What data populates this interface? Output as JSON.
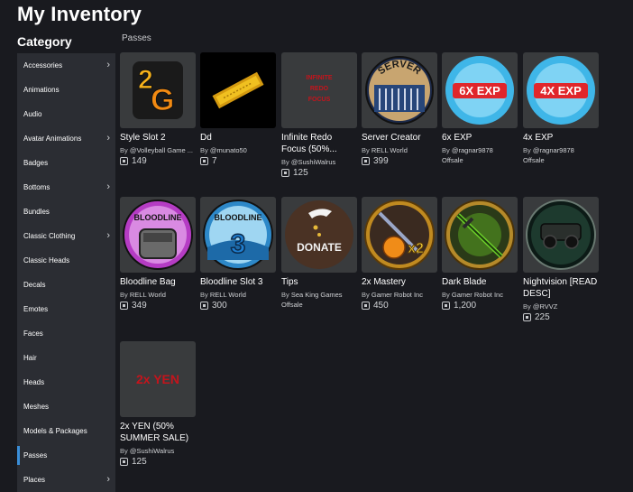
{
  "page_title": "My Inventory",
  "category_title": "Category",
  "section_label": "Passes",
  "sidebar": {
    "items": [
      {
        "label": "Accessories",
        "chevron": true
      },
      {
        "label": "Animations",
        "chevron": false
      },
      {
        "label": "Audio",
        "chevron": false
      },
      {
        "label": "Avatar Animations",
        "chevron": true
      },
      {
        "label": "Badges",
        "chevron": false
      },
      {
        "label": "Bottoms",
        "chevron": true
      },
      {
        "label": "Bundles",
        "chevron": false
      },
      {
        "label": "Classic Clothing",
        "chevron": true
      },
      {
        "label": "Classic Heads",
        "chevron": false
      },
      {
        "label": "Decals",
        "chevron": false
      },
      {
        "label": "Emotes",
        "chevron": false
      },
      {
        "label": "Faces",
        "chevron": false
      },
      {
        "label": "Hair",
        "chevron": false
      },
      {
        "label": "Heads",
        "chevron": false
      },
      {
        "label": "Meshes",
        "chevron": false
      },
      {
        "label": "Models & Packages",
        "chevron": false
      },
      {
        "label": "Passes",
        "chevron": false,
        "active": true
      },
      {
        "label": "Places",
        "chevron": true
      }
    ]
  },
  "items": [
    {
      "name": "Style Slot 2",
      "by": "By",
      "creator": "@Volleyball Game ...",
      "price": "149",
      "icon": "style-slot-icon"
    },
    {
      "name": "Dd",
      "by": "By",
      "creator": "@munato50",
      "price": "7",
      "icon": "gold-ticket-icon"
    },
    {
      "name": "Infinite Redo Focus (50%...",
      "by": "By",
      "creator": "@SushiWalrus",
      "price": "125",
      "icon": "text-thumb-icon",
      "thumb_text": "INFINITE REDO FOCUS"
    },
    {
      "name": "Server Creator",
      "by": "By",
      "creator": "RELL World",
      "price": "399",
      "icon": "server-icon",
      "thumb_text": "SERVER"
    },
    {
      "name": "6x EXP",
      "by": "By",
      "creator": "@ragnar9878",
      "offsale": "Offsale",
      "icon": "exp-6x-icon",
      "thumb_text": "6X EXP"
    },
    {
      "name": "4x EXP",
      "by": "By",
      "creator": "@ragnar9878",
      "offsale": "Offsale",
      "icon": "exp-4x-icon",
      "thumb_text": "4X EXP"
    },
    {
      "name": "Bloodline Bag",
      "by": "By",
      "creator": "RELL World",
      "price": "349",
      "icon": "bloodline-bag-icon",
      "thumb_text": "BLOODLINE"
    },
    {
      "name": "Bloodline Slot 3",
      "by": "By",
      "creator": "RELL World",
      "price": "300",
      "icon": "bloodline-slot-icon",
      "thumb_text": "BLOODLINE"
    },
    {
      "name": "Tips",
      "by": "By",
      "creator": "Sea King Games",
      "offsale": "Offsale",
      "icon": "donate-icon",
      "thumb_text": "DONATE"
    },
    {
      "name": "2x Mastery",
      "by": "By",
      "creator": "Gamer Robot Inc",
      "price": "450",
      "icon": "mastery-icon",
      "thumb_text": "x2"
    },
    {
      "name": "Dark Blade",
      "by": "By",
      "creator": "Gamer Robot Inc",
      "price": "1,200",
      "icon": "dark-blade-icon"
    },
    {
      "name": "Nightvision [READ DESC]",
      "by": "By",
      "creator": "@RVVZ",
      "price": "225",
      "icon": "nightvision-icon"
    },
    {
      "name": "2x YEN (50% SUMMER SALE)",
      "by": "By",
      "creator": "@SushiWalrus",
      "price": "125",
      "icon": "text-thumb-icon",
      "thumb_text": "2x YEN"
    }
  ],
  "colors": {
    "background": "#191a1f",
    "sidebar": "#2b2d33",
    "thumb": "#393b3d",
    "active_indicator": "#3a8ed8"
  }
}
